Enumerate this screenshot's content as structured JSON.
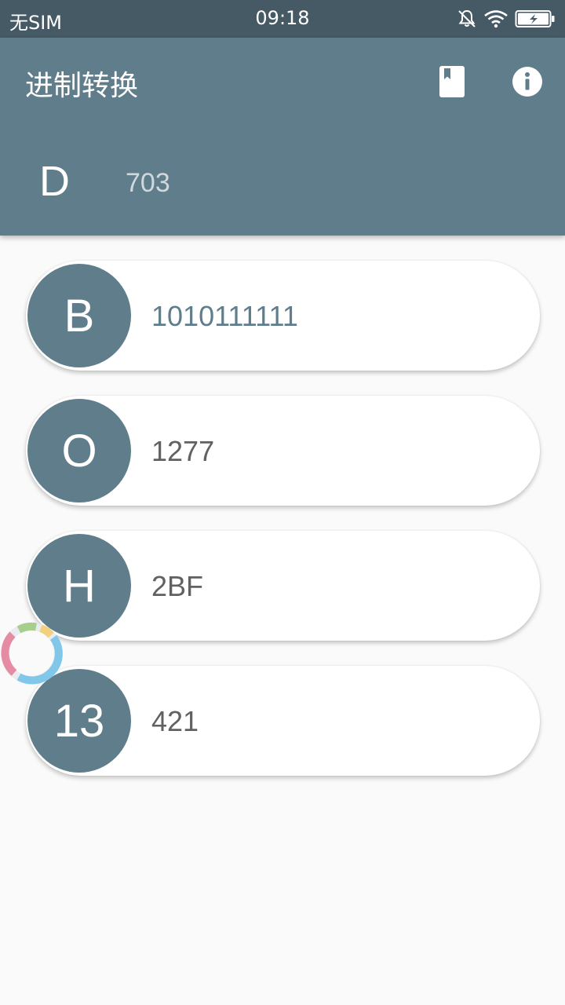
{
  "status_bar": {
    "sim": "无SIM",
    "time": "09:18",
    "icons": [
      "mute-bell-icon",
      "wifi-icon",
      "battery-charging-icon"
    ]
  },
  "app_bar": {
    "title": "进制转换",
    "actions": [
      "book-icon",
      "info-icon"
    ],
    "input": {
      "prefix": "D",
      "value": "703"
    }
  },
  "results": [
    {
      "label": "B",
      "value": "1010111111"
    },
    {
      "label": "O",
      "value": "1277"
    },
    {
      "label": "H",
      "value": "2BF"
    },
    {
      "label": "13",
      "value": "421"
    }
  ],
  "colors": {
    "status_bar": "#455a64",
    "primary": "#607d8b",
    "background": "#fafafa",
    "card": "#ffffff"
  }
}
